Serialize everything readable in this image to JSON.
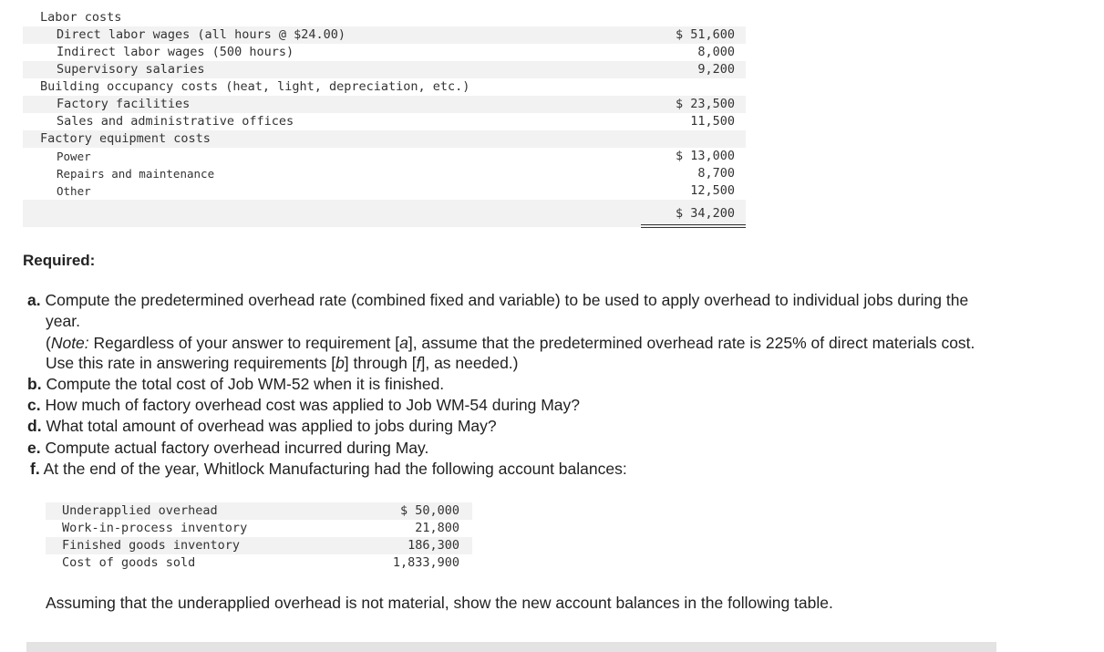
{
  "cost_table": {
    "rows": [
      {
        "label": "Labor costs",
        "amount": ""
      },
      {
        "label": "Direct labor wages (all hours @ $24.00)",
        "amount": "$ 51,600"
      },
      {
        "label": "Indirect labor wages (500 hours)",
        "amount": "8,000"
      },
      {
        "label": "Supervisory salaries",
        "amount": "9,200"
      },
      {
        "label": "Building occupancy costs (heat, light, depreciation, etc.)",
        "amount": ""
      },
      {
        "label": "Factory facilities",
        "amount": "$ 23,500"
      },
      {
        "label": "Sales and administrative offices",
        "amount": "11,500"
      },
      {
        "label": "Factory equipment costs",
        "amount": ""
      },
      {
        "label": "Power",
        "amount": "$ 13,000"
      },
      {
        "label": "Repairs and maintenance",
        "amount": "8,700"
      },
      {
        "label": "Other",
        "amount": "12,500"
      },
      {
        "label": "",
        "amount": "$ 34,200"
      }
    ]
  },
  "required": {
    "heading": "Required:",
    "a_key": "a.",
    "a_text": "Compute the predetermined overhead rate (combined fixed and variable) to be used to apply overhead to individual jobs during the",
    "a_text2": "year.",
    "note_open": "(",
    "note_word": "Note:",
    "note_text1": " Regardless of your answer to requirement [",
    "note_a": "a",
    "note_text2": "], assume that the predetermined overhead rate is 225% of direct materials cost.",
    "note_line2a": "Use this rate in answering requirements [",
    "note_b": "b",
    "note_line2b": "] through [",
    "note_f": "f",
    "note_line2c": "], as needed.)",
    "b_key": "b.",
    "b_text": "Compute the total cost of Job WM-52 when it is finished.",
    "c_key": "c.",
    "c_text": "How much of factory overhead cost was applied to Job WM-54 during May?",
    "d_key": "d.",
    "d_text": "What total amount of overhead was applied to jobs during May?",
    "e_key": "e.",
    "e_text": "Compute actual factory overhead incurred during May.",
    "f_key": "f.",
    "f_text": "At the end of the year, Whitlock Manufacturing had the following account balances:"
  },
  "balances": [
    {
      "label": "Underapplied overhead",
      "amount": "$ 50,000"
    },
    {
      "label": "Work-in-process inventory",
      "amount": "21,800"
    },
    {
      "label": "Finished goods inventory",
      "amount": "186,300"
    },
    {
      "label": "Cost of goods sold",
      "amount": "1,833,900"
    }
  ],
  "assume_text": "Assuming that the underapplied overhead is not material, show the new account balances in the following table."
}
